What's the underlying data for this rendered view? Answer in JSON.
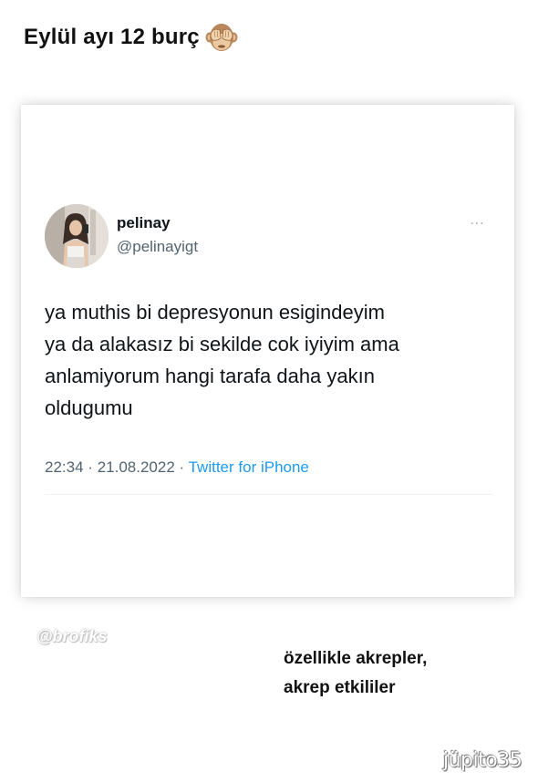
{
  "story": {
    "title": "Eylül ayı 12 burç",
    "title_emoji": "see-no-evil-monkey"
  },
  "tweet": {
    "author_name": "pelinay",
    "author_handle": "@pelinayigt",
    "text_lines": [
      "ya muthis bi depresyonun esigindeyim",
      "ya da alakasız bi sekilde cok iyiyim ama",
      "anlamiyorum hangi tarafa daha yakın",
      "oldugumu"
    ],
    "time": "22:34",
    "date": "21.08.2022",
    "separator": "·",
    "source": "Twitter for iPhone",
    "more_icon": "⋯"
  },
  "caption": {
    "line1": "özellikle akrepler,",
    "line2": "akrep etkililer"
  },
  "watermarks": {
    "left": "@brofiks",
    "right": "jüpito35"
  },
  "colors": {
    "handle_gray": "#536471",
    "source_blue": "#1d9bf0",
    "text_dark": "#0f1419"
  }
}
